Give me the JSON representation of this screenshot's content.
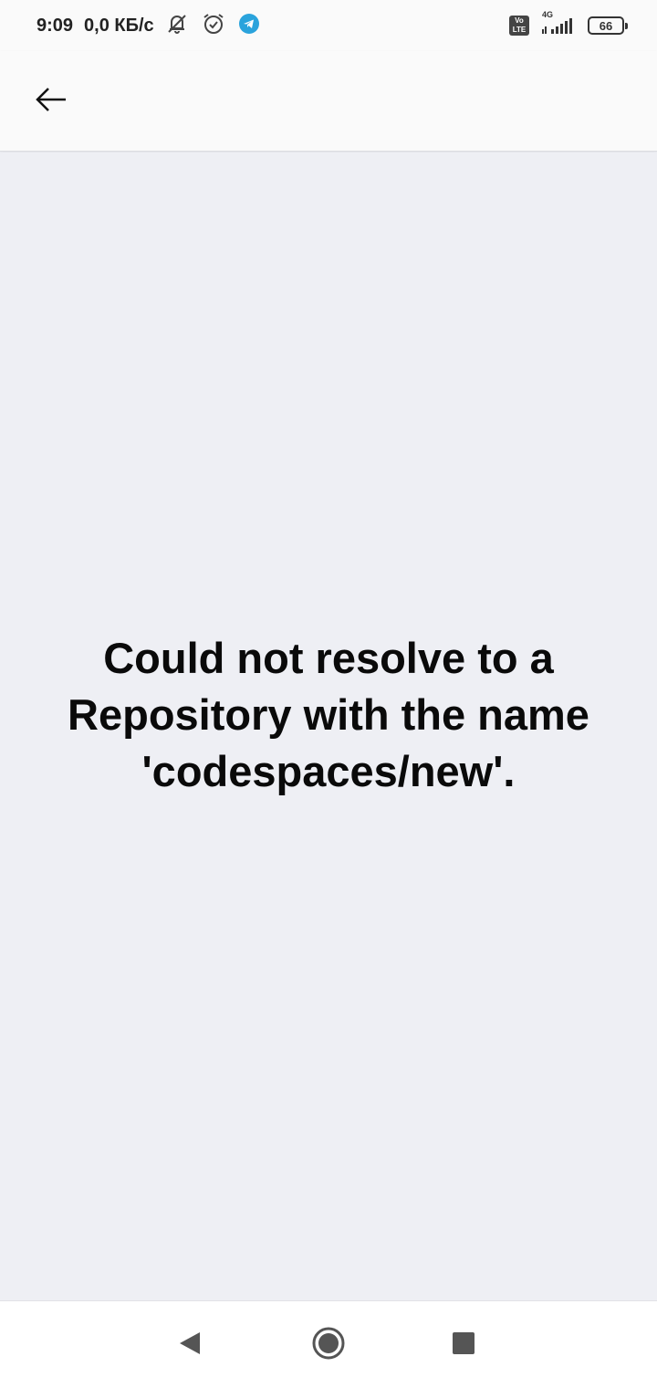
{
  "status_bar": {
    "time": "9:09",
    "speed": "0,0 КБ/с",
    "volte_line1": "Vo",
    "volte_line2": "LTE",
    "network": "4G",
    "battery": "66",
    "icons": [
      "muted-bell-icon",
      "alarm-icon",
      "telegram-icon",
      "volte-icon",
      "signal-icon",
      "battery-icon"
    ],
    "telegram_color": "#2aa3dc"
  },
  "app_bar": {
    "back_icon": "arrow-left-icon"
  },
  "main": {
    "error_message": "Could not resolve to a Repository with the name 'codespaces/new'."
  },
  "nav_bar": {
    "icons": [
      "nav-back-icon",
      "nav-home-icon",
      "nav-recents-icon"
    ]
  }
}
